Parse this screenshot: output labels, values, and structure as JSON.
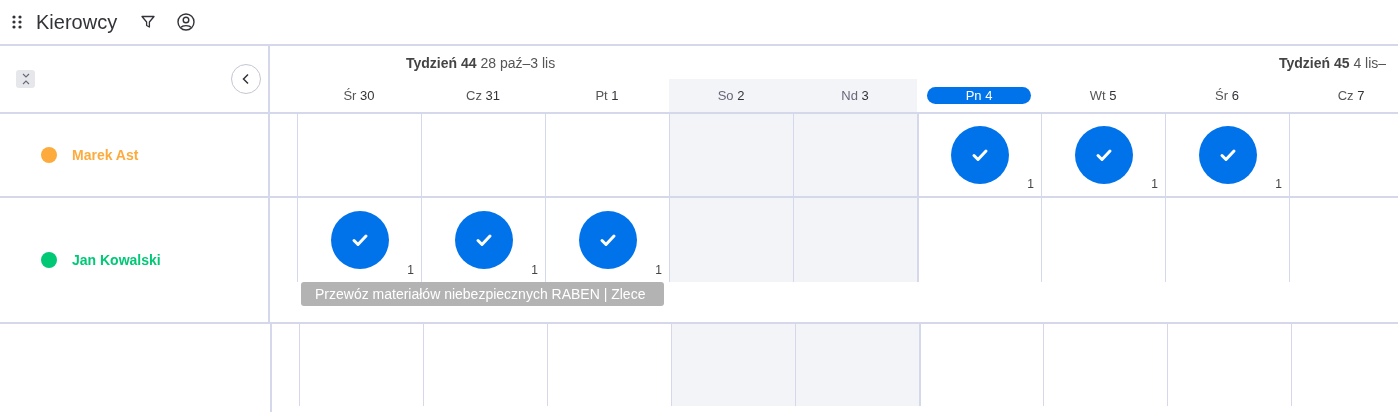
{
  "title": "Kierowcy",
  "weeks": [
    {
      "label": "Tydzień 44",
      "range": "28 paź–3 lis",
      "days": [
        {
          "weekday": "Śr",
          "num": "30",
          "weekend": false,
          "selected": false
        },
        {
          "weekday": "Cz",
          "num": "31",
          "weekend": false,
          "selected": false
        },
        {
          "weekday": "Pt",
          "num": "1",
          "weekend": false,
          "selected": false
        },
        {
          "weekday": "So",
          "num": "2",
          "weekend": true,
          "selected": false
        },
        {
          "weekday": "Nd",
          "num": "3",
          "weekend": true,
          "selected": false
        }
      ]
    },
    {
      "label": "Tydzień 45",
      "range": "4 lis–",
      "days": [
        {
          "weekday": "Pn",
          "num": "4",
          "weekend": false,
          "selected": true
        },
        {
          "weekday": "Wt",
          "num": "5",
          "weekend": false,
          "selected": false
        },
        {
          "weekday": "Śr",
          "num": "6",
          "weekend": false,
          "selected": false
        },
        {
          "weekday": "Cz",
          "num": "7",
          "weekend": false,
          "selected": false
        }
      ]
    }
  ],
  "drivers": [
    {
      "name": "Marek Ast",
      "color": "#fdab3d",
      "cells": [
        {
          "checked": false
        },
        {
          "checked": false
        },
        {
          "checked": false
        },
        {
          "checked": false
        },
        {
          "checked": false
        },
        {
          "checked": true,
          "count": "1"
        },
        {
          "checked": true,
          "count": "1"
        },
        {
          "checked": true,
          "count": "1"
        },
        {
          "checked": false
        }
      ]
    },
    {
      "name": "Jan Kowalski",
      "color": "#00c875",
      "cells": [
        {
          "checked": true,
          "count": "1"
        },
        {
          "checked": true,
          "count": "1"
        },
        {
          "checked": true,
          "count": "1"
        },
        {
          "checked": false
        },
        {
          "checked": false
        },
        {
          "checked": false
        },
        {
          "checked": false
        },
        {
          "checked": false
        },
        {
          "checked": false
        }
      ],
      "task": "Przewóz materiałów niebezpiecznych RABEN | Zlece"
    }
  ]
}
